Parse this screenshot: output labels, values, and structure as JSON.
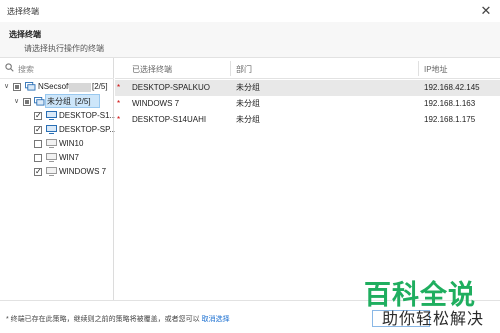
{
  "window": {
    "title": "选择终端",
    "close_glyph": "✕"
  },
  "header": {
    "heading": "选择终端",
    "subheading": "请选择执行操作的终端"
  },
  "search": {
    "placeholder": "搜索"
  },
  "tree": {
    "root": {
      "name": "NSecsoft",
      "count": "[2/5]"
    },
    "group": {
      "name": "未分组",
      "count": "[2/5]"
    },
    "items": [
      {
        "label": "DESKTOP-S1...",
        "checked": true
      },
      {
        "label": "DESKTOP-SP...",
        "checked": true
      },
      {
        "label": "WIN10",
        "checked": false
      },
      {
        "label": "WIN7",
        "checked": false
      },
      {
        "label": "WINDOWS 7",
        "checked": true
      }
    ]
  },
  "table": {
    "columns": [
      "已选择终端",
      "部门",
      "IP地址"
    ],
    "rows": [
      {
        "mark": "*",
        "name": "DESKTOP-SPALKUO",
        "dept": "未分组",
        "ip": "192.168.42.145",
        "selected": true
      },
      {
        "mark": "*",
        "name": "WINDOWS 7",
        "dept": "未分组",
        "ip": "192.168.1.163",
        "selected": false
      },
      {
        "mark": "*",
        "name": "DESKTOP-S14UAHI",
        "dept": "未分组",
        "ip": "192.168.1.175",
        "selected": false
      }
    ]
  },
  "footer": {
    "note": "* 终端已存在此策略，继续则之前的策略将被覆盖，或者您可以",
    "link": "取消选择"
  },
  "watermark": {
    "line1": "百科全说",
    "line2": "助你轻松解决"
  },
  "colors": {
    "accent": "#1a6fd1",
    "selection": "#cde6fa",
    "brand_green": "#1fae5f"
  }
}
